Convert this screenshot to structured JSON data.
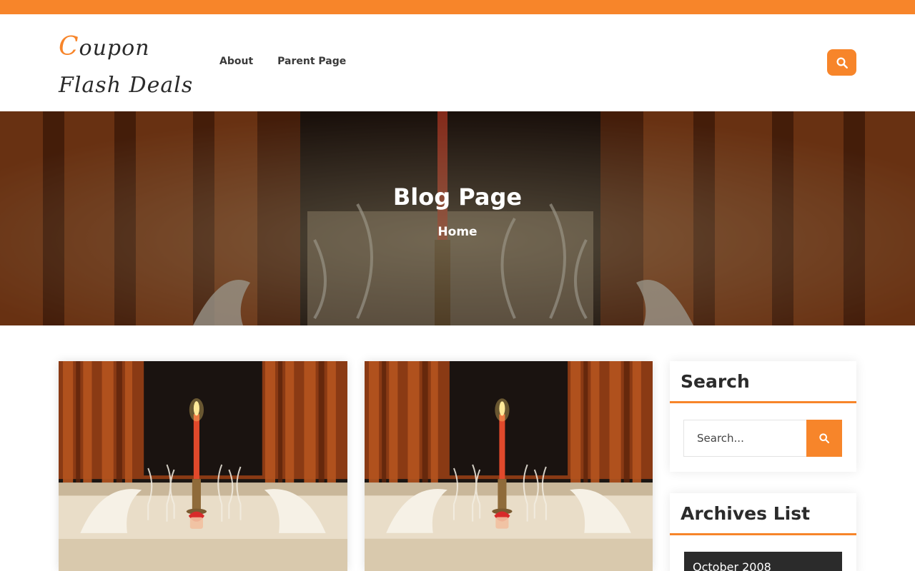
{
  "brand": {
    "logo_first": "C",
    "logo_rest": "oupon Flash Deals",
    "accent_color": "#f7852a"
  },
  "nav": {
    "items": [
      {
        "label": "About"
      },
      {
        "label": "Parent Page"
      }
    ]
  },
  "header": {
    "search_icon": "search-icon"
  },
  "hero": {
    "title": "Blog Page",
    "breadcrumb": "Home"
  },
  "posts": [
    {
      "image": "candlelit-dinner-table"
    },
    {
      "image": "candlelit-dinner-table"
    }
  ],
  "sidebar": {
    "search": {
      "title": "Search",
      "placeholder": "Search...",
      "button_icon": "search-icon"
    },
    "archives": {
      "title": "Archives List",
      "items": [
        {
          "label": "October 2008"
        }
      ]
    }
  }
}
